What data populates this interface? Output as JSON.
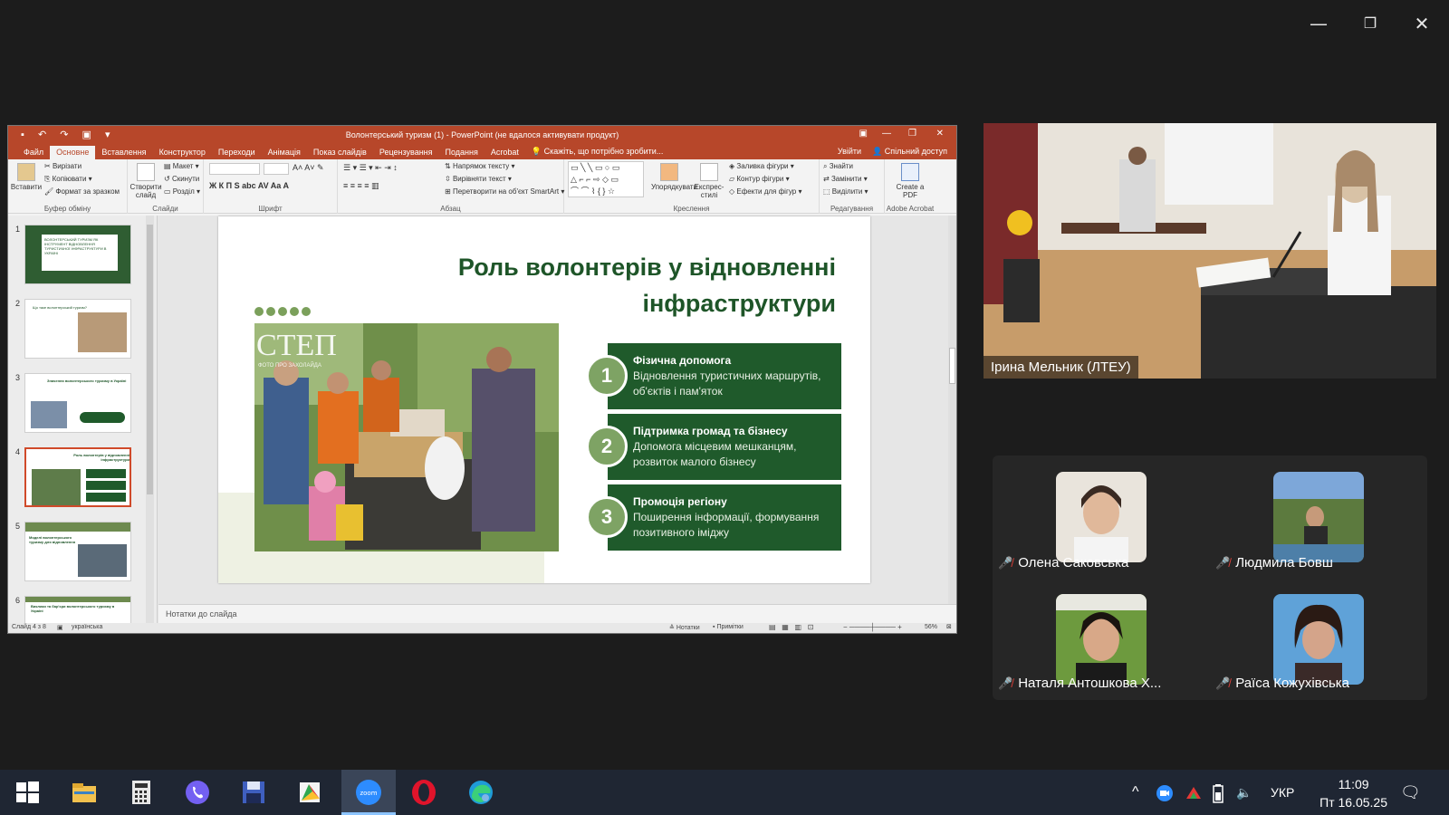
{
  "window_controls": {
    "minimize": "—",
    "restore": "❐",
    "close": "✕"
  },
  "ppt": {
    "title": "Волонтерський туризм (1) - PowerPoint (не вдалося активувати продукт)",
    "tabs": [
      "Файл",
      "Основне",
      "Вставлення",
      "Конструктор",
      "Переходи",
      "Анімація",
      "Показ слайдів",
      "Рецензування",
      "Подання",
      "Acrobat"
    ],
    "tell_me": "Скажіть, що потрібно зробити...",
    "signin": "Увійти",
    "share": "Спільний доступ",
    "ribbon": {
      "paste": "Вставити",
      "cut": "Вирізати",
      "copy": "Копіювати",
      "format_painter": "Формат за зразком",
      "clipboard_group": "Буфер обміну",
      "new_slide": "Створити слайд",
      "layout": "Макет",
      "reset": "Скинути",
      "section": "Розділ",
      "slides_group": "Слайди",
      "font_group": "Шрифт",
      "text_direction": "Напрямок тексту",
      "align_text": "Вирівняти текст",
      "smartart": "Перетворити на об'єкт SmartArt",
      "paragraph_group": "Абзац",
      "arrange": "Упорядкувати",
      "quick_styles": "Експрес-стилі",
      "shape_fill": "Заливка фігури",
      "shape_outline": "Контур фігури",
      "shape_effects": "Ефекти для фігур",
      "drawing_group": "Креслення",
      "find": "Знайти",
      "replace": "Замінити",
      "select": "Виділити",
      "editing_group": "Редагування",
      "create_pdf": "Create a PDF",
      "acrobat_group": "Adobe Acrobat"
    },
    "thumbnails": [
      {
        "n": "1",
        "text": "ВОЛОНТЕРСЬКИЙ ТУРИЗМ ЯК ІНСТРУМЕНТ ВІДНОВЛЕННЯ ТУРИСТИЧНОЇ ІНФРАСТРУКТУРИ В УКРАЇНІ"
      },
      {
        "n": "2",
        "text": "Що таке волонтерський туризм?"
      },
      {
        "n": "3",
        "text": "Значення волонтерського туризму в Україні"
      },
      {
        "n": "4",
        "text": "Роль волонтерів у відновленні інфраструктури"
      },
      {
        "n": "5",
        "text": "Моделі волонтерського туризму для відновлення"
      },
      {
        "n": "6",
        "text": "Виклики та бар'єри волонтерського туризму в Україні"
      }
    ],
    "notes_placeholder": "Нотатки до слайда",
    "status": {
      "slide": "Слайд 4 з 8",
      "language": "українська",
      "notes": "Нотатки",
      "comments": "Примітки",
      "zoom": "56%"
    }
  },
  "slide": {
    "title_line1": "Роль волонтерів у відновленні",
    "title_line2": "інфраструктури",
    "photo_watermark": "СТЕП",
    "photo_watermark_sub": "ФОТО ПРО ЗАХОЛАЙДА",
    "cards": [
      {
        "num": "1",
        "title": "Фізична допомога",
        "desc": "Відновлення туристичних маршрутів, об'єктів і пам'яток"
      },
      {
        "num": "2",
        "title": "Підтримка громад та бізнесу",
        "desc": "Допомога місцевим мешканцям, розвиток малого бізнесу"
      },
      {
        "num": "3",
        "title": "Промоція регіону",
        "desc": "Поширення інформації, формування позитивного іміджу"
      }
    ]
  },
  "zoom": {
    "speaker_name": "Ірина Мельник (ЛТЕУ)",
    "participants": [
      {
        "name": "Олена Саковська"
      },
      {
        "name": "Людмила Бовш"
      },
      {
        "name": "Наталя Антошкова Х..."
      },
      {
        "name": "Раїса Кожухівська"
      }
    ]
  },
  "taskbar": {
    "zoom_label": "zoom",
    "language": "УКР",
    "time": "11:09",
    "date": "Пт 16.05.25"
  },
  "colors": {
    "ppt_accent": "#b7472a",
    "slide_green": "#1f5a2b",
    "slide_light_green": "#7ea364",
    "taskbar": "#1f2633"
  }
}
